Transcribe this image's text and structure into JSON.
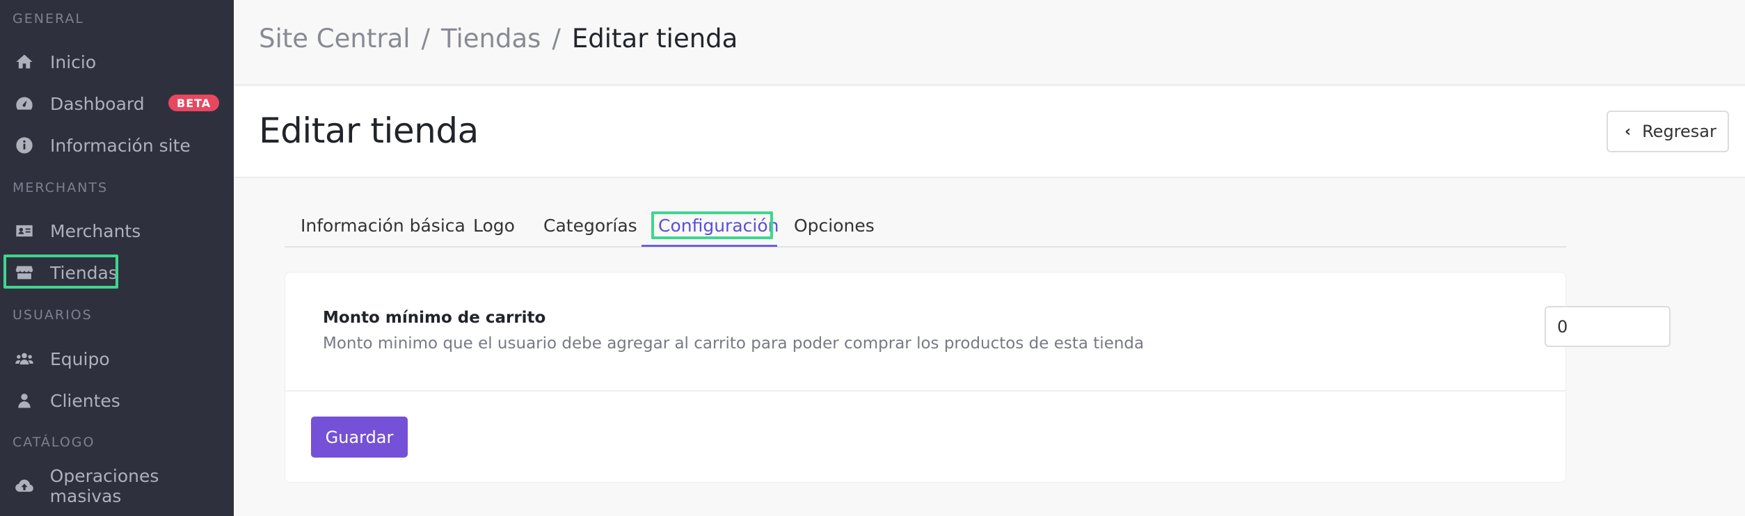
{
  "sidebar": {
    "sections": [
      {
        "label": "GENERAL"
      },
      {
        "label": "MERCHANTS"
      },
      {
        "label": "USUARIOS"
      },
      {
        "label": "CATÁLOGO"
      }
    ],
    "items": [
      {
        "label": "Inicio",
        "icon": "home-icon"
      },
      {
        "label": "Dashboard",
        "icon": "gauge-icon",
        "badge": "BETA"
      },
      {
        "label": "Información site",
        "icon": "info-icon"
      },
      {
        "label": "Merchants",
        "icon": "id-card-icon"
      },
      {
        "label": "Tiendas",
        "icon": "store-icon",
        "highlighted": true
      },
      {
        "label": "Equipo",
        "icon": "users-icon"
      },
      {
        "label": "Clientes",
        "icon": "user-icon"
      },
      {
        "label": "Operaciones masivas",
        "icon": "cloud-upload-icon"
      }
    ]
  },
  "breadcrumb": {
    "items": [
      "Site Central",
      "Tiendas",
      "Editar tienda"
    ],
    "separator": "/"
  },
  "page": {
    "title": "Editar tienda",
    "back_label": "Regresar"
  },
  "tabs": [
    {
      "label": "Información básica"
    },
    {
      "label": "Logo"
    },
    {
      "label": "Categorías"
    },
    {
      "label": "Configuración",
      "active": true
    },
    {
      "label": "Opciones"
    }
  ],
  "form": {
    "field_label": "Monto mínimo de carrito",
    "field_help": "Monto minimo que el usuario debe agregar al carrito para poder comprar los productos de esta tienda",
    "field_value": "0",
    "save_label": "Guardar"
  },
  "colors": {
    "sidebar_bg": "#2e313d",
    "accent": "#7451d6",
    "active_tab": "#5a4fd6",
    "badge": "#e8475f",
    "highlight": "#3fd68f"
  }
}
